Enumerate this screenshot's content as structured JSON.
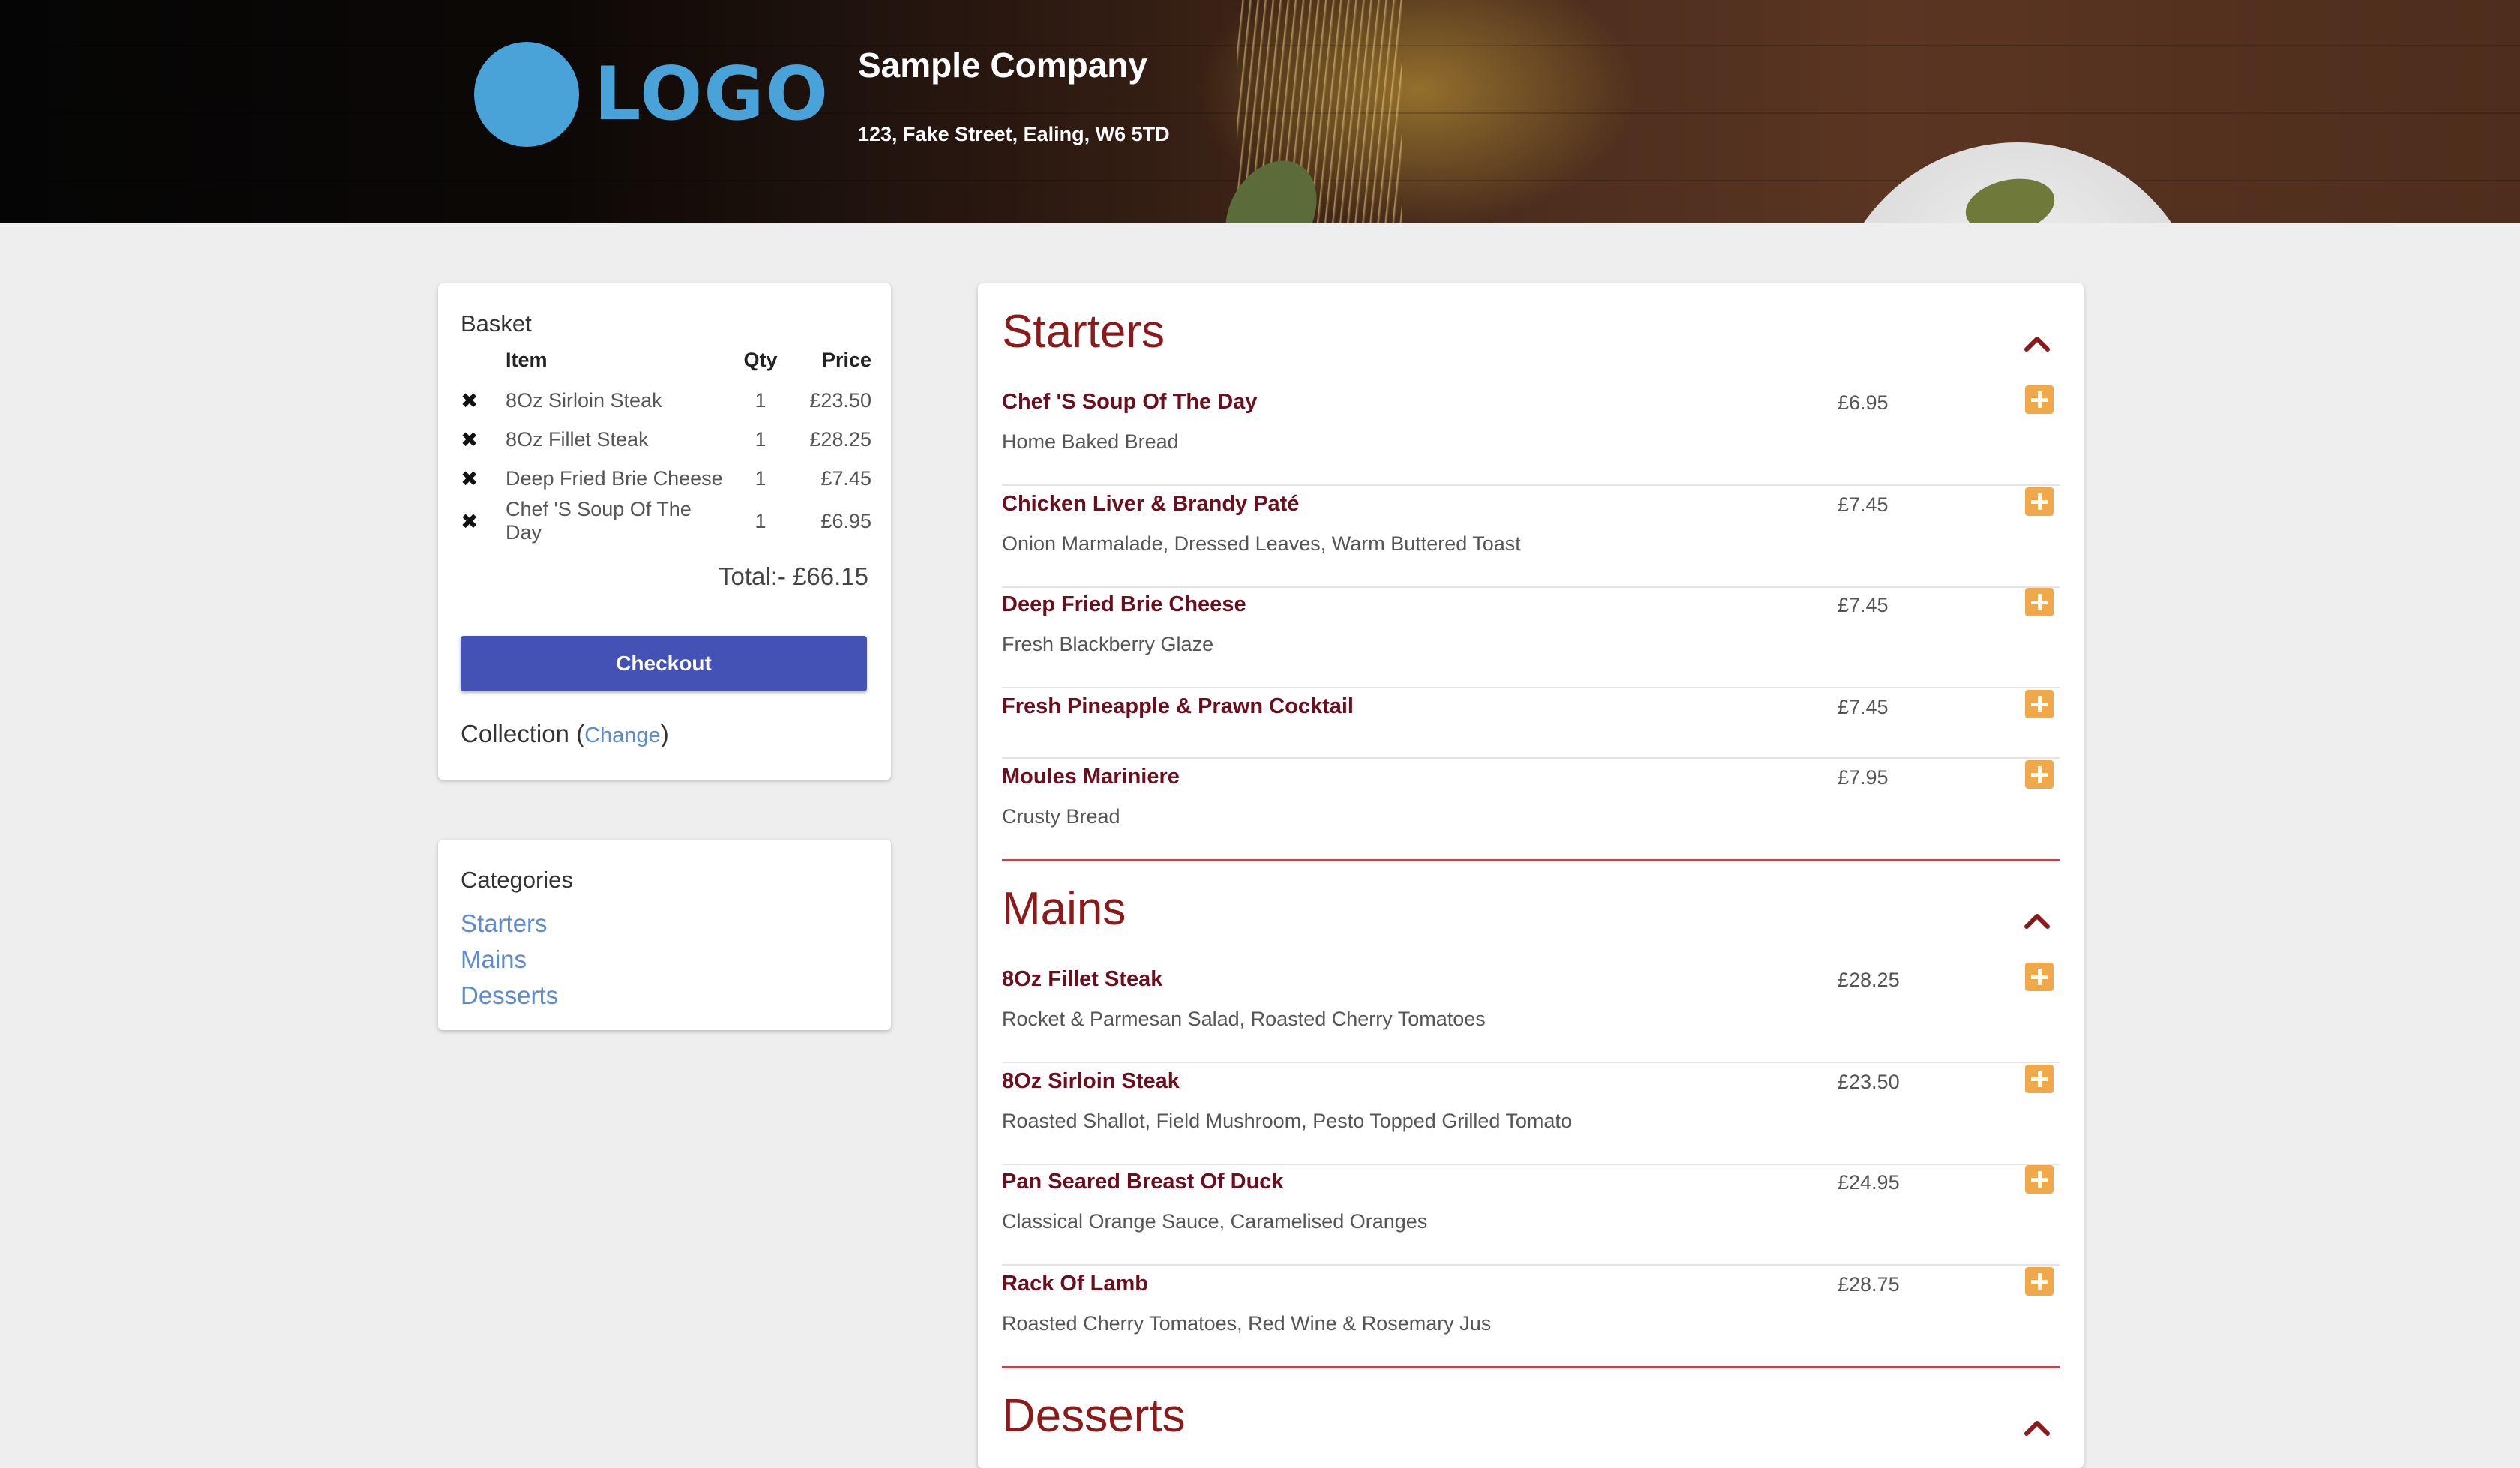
{
  "header": {
    "logo_text": "LOGO",
    "company_name": "Sample Company",
    "address": "123, Fake Street, Ealing, W6 5TD"
  },
  "basket": {
    "title": "Basket",
    "columns": [
      "Item",
      "Qty",
      "Price"
    ],
    "items": [
      {
        "name": "8Oz Sirloin Steak",
        "qty": "1",
        "price": "£23.50"
      },
      {
        "name": "8Oz Fillet Steak",
        "qty": "1",
        "price": "£28.25"
      },
      {
        "name": "Deep Fried Brie Cheese",
        "qty": "1",
        "price": "£7.45"
      },
      {
        "name": "Chef 'S Soup Of The Day",
        "qty": "1",
        "price": "£6.95"
      }
    ],
    "remove_glyph": "✖",
    "total": "Total:- £66.15",
    "checkout_label": "Checkout",
    "collection_label": "Collection",
    "collection_open": " (",
    "change_label": "Change",
    "collection_close": ")"
  },
  "categories": {
    "title": "Categories",
    "items": [
      "Starters",
      "Mains",
      "Desserts"
    ]
  },
  "menu": {
    "sections": [
      {
        "title": "Starters",
        "items": [
          {
            "name": "Chef 'S Soup Of The Day",
            "price": "£6.95",
            "description": "Home Baked Bread"
          },
          {
            "name": "Chicken Liver & Brandy Paté",
            "price": "£7.45",
            "description": "Onion Marmalade, Dressed Leaves, Warm Buttered Toast"
          },
          {
            "name": "Deep Fried Brie Cheese",
            "price": "£7.45",
            "description": "Fresh Blackberry Glaze"
          },
          {
            "name": "Fresh Pineapple & Prawn Cocktail",
            "price": "£7.45",
            "description": ""
          },
          {
            "name": "Moules Mariniere",
            "price": "£7.95",
            "description": "Crusty Bread"
          }
        ]
      },
      {
        "title": "Mains",
        "items": [
          {
            "name": "8Oz Fillet Steak",
            "price": "£28.25",
            "description": "Rocket & Parmesan Salad, Roasted Cherry Tomatoes"
          },
          {
            "name": "8Oz Sirloin Steak",
            "price": "£23.50",
            "description": "Roasted Shallot, Field Mushroom, Pesto Topped Grilled Tomato"
          },
          {
            "name": "Pan Seared Breast Of Duck",
            "price": "£24.95",
            "description": "Classical Orange Sauce, Caramelised Oranges"
          },
          {
            "name": "Rack Of Lamb",
            "price": "£28.75",
            "description": "Roasted Cherry Tomatoes, Red Wine & Rosemary Jus"
          }
        ]
      },
      {
        "title": "Desserts",
        "items": []
      }
    ]
  },
  "colors": {
    "accent_blue": "#4352b4",
    "link_blue": "#5d8ad0",
    "item_name": "#6b0f1e",
    "section_title": "#8b1a1a",
    "add_button": "#f0a94a",
    "logo": "#4aa3d8"
  },
  "icons": {
    "remove": "close-x-icon",
    "add": "plus-square-icon",
    "collapse": "chevron-up-icon"
  }
}
